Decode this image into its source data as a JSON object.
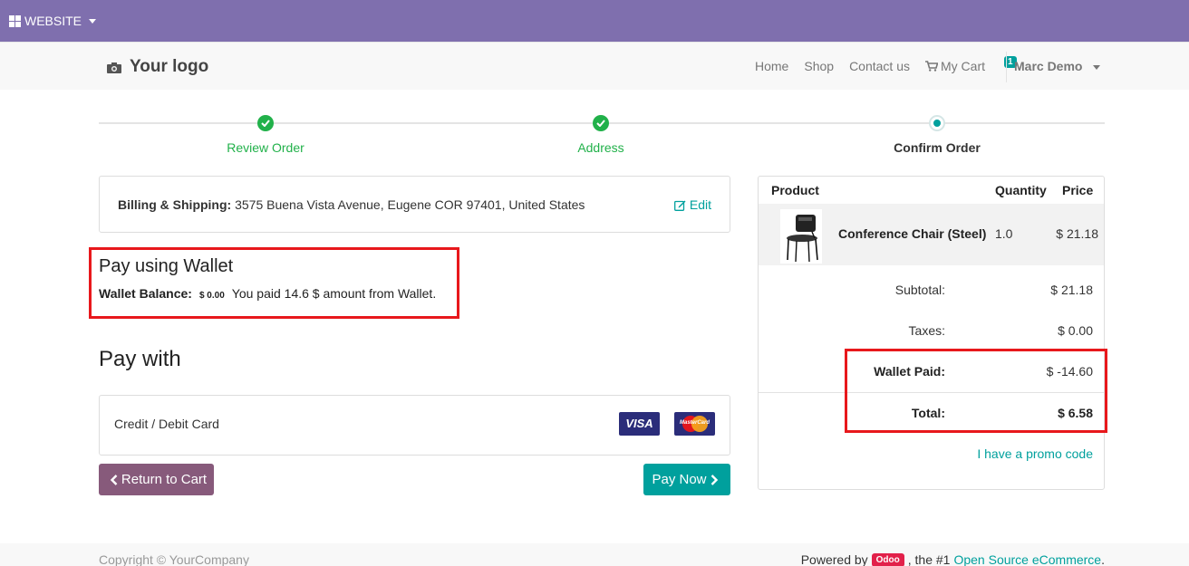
{
  "topbar": {
    "menu_label": "WEBSITE",
    "color": "#7f6fae"
  },
  "navbar": {
    "logo_text": "Your logo",
    "links": [
      "Home",
      "Shop",
      "Contact us"
    ],
    "cart_label": "My Cart",
    "cart_count": "1",
    "user": "Marc Demo"
  },
  "wizard": {
    "steps": [
      {
        "label": "Review Order",
        "state": "done"
      },
      {
        "label": "Address",
        "state": "done"
      },
      {
        "label": "Confirm Order",
        "state": "current"
      }
    ]
  },
  "billing": {
    "label": "Billing & Shipping:",
    "address": "3575 Buena Vista Avenue, Eugene COR 97401, United States",
    "edit_label": "Edit"
  },
  "wallet": {
    "title": "Pay using Wallet",
    "balance_label": "Wallet Balance:",
    "balance_value": "$ 0.00",
    "message": "You paid 14.6 $ amount from Wallet."
  },
  "payment": {
    "title": "Pay with",
    "method_label": "Credit / Debit Card",
    "visa_text": "VISA",
    "mastercard_text": "MasterCard"
  },
  "buttons": {
    "return_label": "Return to Cart",
    "pay_label": "Pay Now"
  },
  "summary": {
    "headers": {
      "product": "Product",
      "quantity": "Quantity",
      "price": "Price"
    },
    "items": [
      {
        "name": "Conference Chair (Steel)",
        "quantity": "1.0",
        "price": "$ 21.18"
      }
    ],
    "subtotal_label": "Subtotal:",
    "subtotal_value": "$ 21.18",
    "taxes_label": "Taxes:",
    "taxes_value": "$ 0.00",
    "wallet_paid_label": "Wallet Paid:",
    "wallet_paid_value": "$ -14.60",
    "total_label": "Total:",
    "total_value": "$ 6.58",
    "promo_label": "I have a promo code"
  },
  "footer": {
    "copyright": "Copyright © YourCompany",
    "powered_by": "Powered by",
    "odoo_badge": "Odoo",
    "suffix": ", the #1",
    "oss_link": "Open Source eCommerce",
    "period": "."
  },
  "colors": {
    "primary": "#00a09d",
    "secondary": "#875a7b",
    "success": "#21b14a",
    "highlight": "#e8181c"
  }
}
